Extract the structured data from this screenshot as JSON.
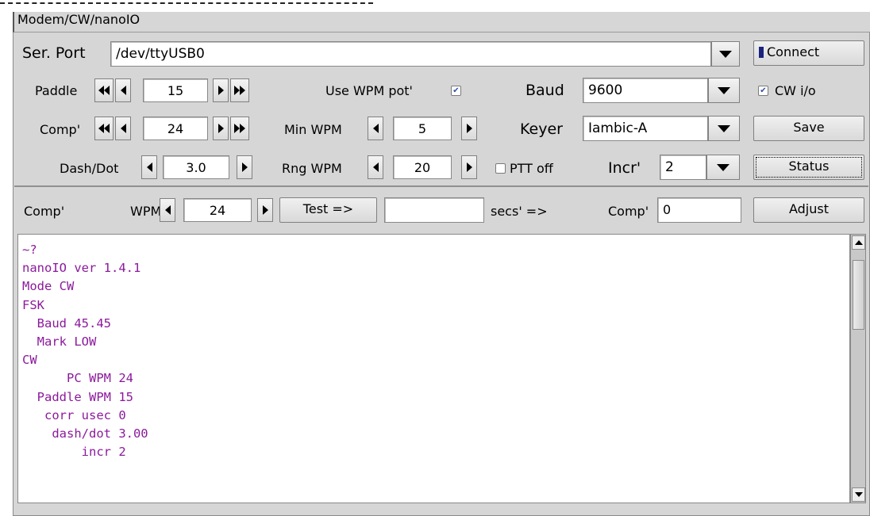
{
  "tab": {
    "title": "Modem/CW/nanoIO"
  },
  "serial": {
    "label": "Ser. Port",
    "value": "/dev/ttyUSB0",
    "connect_label": "Connect"
  },
  "paddle": {
    "label": "Paddle",
    "value": "15"
  },
  "comp": {
    "label": "Comp'",
    "value": "24"
  },
  "dashdot": {
    "label": "Dash/Dot",
    "value": "3.0"
  },
  "use_wpm_pot": {
    "label": "Use WPM pot'",
    "checked": true
  },
  "min_wpm": {
    "label": "Min WPM",
    "value": "5"
  },
  "rng_wpm": {
    "label": "Rng WPM",
    "value": "20"
  },
  "ptt_off": {
    "label": "PTT off",
    "checked": false
  },
  "baud": {
    "label": "Baud",
    "value": "9600"
  },
  "keyer": {
    "label": "Keyer",
    "value": "Iambic-A"
  },
  "incr": {
    "label": "Incr'",
    "value": "2"
  },
  "cw_io": {
    "label": "CW i/o",
    "checked": true
  },
  "buttons": {
    "save": "Save",
    "status": "Status",
    "adjust": "Adjust"
  },
  "comp_row": {
    "comp_label": "Comp'",
    "wpm_label": "WPM",
    "wpm_value": "24",
    "test_label": "Test =>",
    "test_value": "",
    "secs_label": "secs' =>",
    "comp2_label": "Comp'",
    "comp2_value": "0"
  },
  "log": {
    "lines": [
      "~?",
      "nanoIO ver 1.4.1",
      "Mode CW",
      "FSK",
      "  Baud 45.45",
      "  Mark LOW",
      "CW",
      "      PC WPM 24",
      "  Paddle WPM 15",
      "   corr usec 0",
      "    dash/dot 3.00",
      "        incr 2"
    ],
    "text_color": "#8b1a9b"
  },
  "colors": {
    "panel": "#d6d6d6",
    "accent": "#1a237e",
    "check": "#3050a0"
  }
}
